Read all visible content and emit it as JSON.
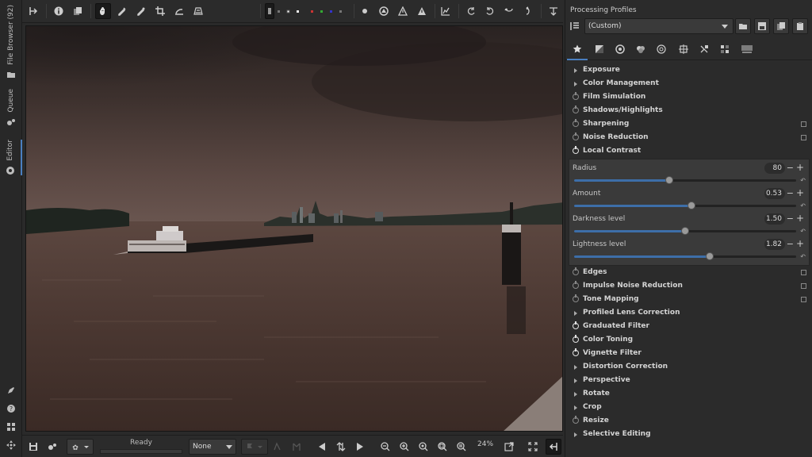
{
  "left_tabs": {
    "file_browser": "File Browser (92)",
    "queue": "Queue",
    "editor": "Editor"
  },
  "top_toolbar": {
    "icons": [
      "split-icon",
      "info-icon",
      "before-after-icon",
      "hand-icon",
      "color-picker-icon",
      "white-balance-icon",
      "crop-icon",
      "straighten-icon",
      "perspective-icon",
      "preview-channel-icon",
      "rgb-icon",
      "focus-mask-icon",
      "clip-shadows-icon",
      "clip-highlights-icon",
      "histogram-icon",
      "rotate-left-icon",
      "rotate-right-icon",
      "flip-h-icon",
      "flip-v-icon",
      "redock-icon"
    ]
  },
  "bottom_toolbar": {
    "status": "Ready",
    "progress": 0,
    "profile_select": "None",
    "zoom_label": "24%"
  },
  "right_panel": {
    "title": "Processing Profiles",
    "profile_value": "(Custom)",
    "tools": [
      {
        "label": "Exposure",
        "kind": "tri",
        "badge": false
      },
      {
        "label": "Color Management",
        "kind": "tri",
        "badge": false
      },
      {
        "label": "Film Simulation",
        "kind": "pw-off",
        "badge": false
      },
      {
        "label": "Shadows/Highlights",
        "kind": "pw-off",
        "badge": false
      },
      {
        "label": "Sharpening",
        "kind": "pw-off",
        "badge": true
      },
      {
        "label": "Noise Reduction",
        "kind": "pw-off",
        "badge": true
      },
      {
        "label": "Local Contrast",
        "kind": "pw-on",
        "badge": false
      }
    ],
    "local_contrast": [
      {
        "label": "Radius",
        "value": "80",
        "fraction": 0.43
      },
      {
        "label": "Amount",
        "value": "0.53",
        "fraction": 0.53
      },
      {
        "label": "Darkness level",
        "value": "1.50",
        "fraction": 0.5
      },
      {
        "label": "Lightness level",
        "value": "1.82",
        "fraction": 0.61
      }
    ],
    "tools_after": [
      {
        "label": "Edges",
        "kind": "pw-off",
        "badge": true
      },
      {
        "label": "Impulse Noise Reduction",
        "kind": "pw-off",
        "badge": true
      },
      {
        "label": "Tone Mapping",
        "kind": "pw-off",
        "badge": true
      },
      {
        "label": "Profiled Lens Correction",
        "kind": "tri",
        "badge": false
      },
      {
        "label": "Graduated Filter",
        "kind": "pw-on",
        "badge": false
      },
      {
        "label": "Color Toning",
        "kind": "pw-on",
        "badge": false
      },
      {
        "label": "Vignette Filter",
        "kind": "pw-on",
        "badge": false
      },
      {
        "label": "Distortion Correction",
        "kind": "tri",
        "badge": false
      },
      {
        "label": "Perspective",
        "kind": "tri",
        "badge": false
      },
      {
        "label": "Rotate",
        "kind": "tri",
        "badge": false
      },
      {
        "label": "Crop",
        "kind": "tri",
        "badge": false
      },
      {
        "label": "Resize",
        "kind": "pw-off",
        "badge": false
      },
      {
        "label": "Selective Editing",
        "kind": "tri",
        "badge": false
      }
    ]
  }
}
